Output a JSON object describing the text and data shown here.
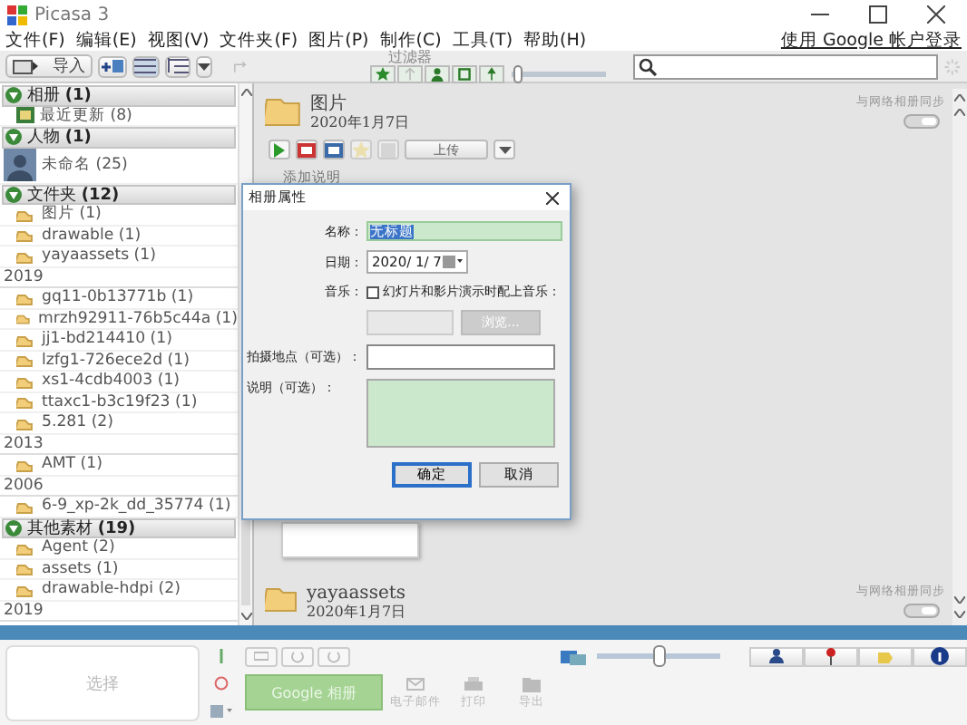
{
  "window": {
    "title": "Picasa 3"
  },
  "menu": [
    "文件(F)",
    "编辑(E)",
    "视图(V)",
    "文件夹(F)",
    "图片(P)",
    "制作(C)",
    "工具(T)",
    "帮助(H)"
  ],
  "account_link": "使用 Google 帐户登录",
  "toolbar": {
    "import_button": "导入",
    "filter_label": "过滤器",
    "filter_slider": {
      "level": 0.05
    }
  },
  "sidebar": {
    "sections": [
      {
        "title": "相册",
        "count": "(1)",
        "expanded": true,
        "items": [
          {
            "kind": "album",
            "label": "最近更新 (8)"
          }
        ]
      },
      {
        "title": "人物",
        "count": "(1)",
        "expanded": true,
        "items": [
          {
            "kind": "person",
            "label": "未命名 (25)"
          }
        ]
      },
      {
        "title": "文件夹",
        "count": "(12)",
        "expanded": true,
        "items": [
          {
            "kind": "folder",
            "label": "图片 (1)"
          },
          {
            "kind": "folder",
            "label": "drawable (1)"
          },
          {
            "kind": "folder",
            "label": "yayaassets (1)"
          },
          {
            "kind": "year",
            "label": "2019"
          },
          {
            "kind": "folder",
            "label": "gq11-0b13771b (1)"
          },
          {
            "kind": "folder",
            "label": "mrzh92911-76b5c44a (1)"
          },
          {
            "kind": "folder",
            "label": "jj1-bd214410 (1)"
          },
          {
            "kind": "folder",
            "label": "lzfg1-726ece2d (1)"
          },
          {
            "kind": "folder",
            "label": "xs1-4cdb4003 (1)"
          },
          {
            "kind": "folder",
            "label": "ttaxc1-b3c19f23 (1)"
          },
          {
            "kind": "folder",
            "label": "5.281 (2)"
          },
          {
            "kind": "year",
            "label": "2013"
          },
          {
            "kind": "folder",
            "label": "AMT (1)"
          },
          {
            "kind": "year",
            "label": "2006"
          },
          {
            "kind": "folder",
            "label": "6-9_xp-2k_dd_35774 (1)"
          }
        ]
      },
      {
        "title": "其他素材",
        "count": "(19)",
        "expanded": true,
        "items": [
          {
            "kind": "folder",
            "label": "Agent (2)"
          },
          {
            "kind": "folder",
            "label": "assets (1)"
          },
          {
            "kind": "folder",
            "label": "drawable-hdpi (2)"
          },
          {
            "kind": "year",
            "label": "2019"
          }
        ]
      }
    ]
  },
  "albums": [
    {
      "title": "图片",
      "date": "2020年1月7日",
      "sync_label": "与网络相册同步",
      "sync_on": false,
      "upload_button": "上传",
      "caption_hint": "添加说明"
    },
    {
      "title": "yayaassets",
      "date": "2020年1月7日",
      "sync_label": "与网络相册同步",
      "sync_on": false
    }
  ],
  "dialog": {
    "title": "相册属性",
    "name_label": "名称：",
    "name_value": "无标题",
    "date_label": "日期：",
    "date_value": "2020/ 1/ 7",
    "music_label": "音乐：",
    "music_checkbox": {
      "label": "幻灯片和影片演示时配上音乐：",
      "checked": false
    },
    "browse_button": "浏览...",
    "location_label": "拍摄地点（可选）：",
    "description_label": "说明（可选）：",
    "buttons": [
      {
        "label": "确定",
        "default": true
      },
      {
        "label": "取消",
        "default": false
      }
    ]
  },
  "tray": {
    "label": "选择",
    "size_slider": {
      "level": 0.5
    }
  },
  "share": {
    "button": "Google 相册",
    "actions": [
      "电子邮件",
      "打印",
      "导出"
    ]
  }
}
